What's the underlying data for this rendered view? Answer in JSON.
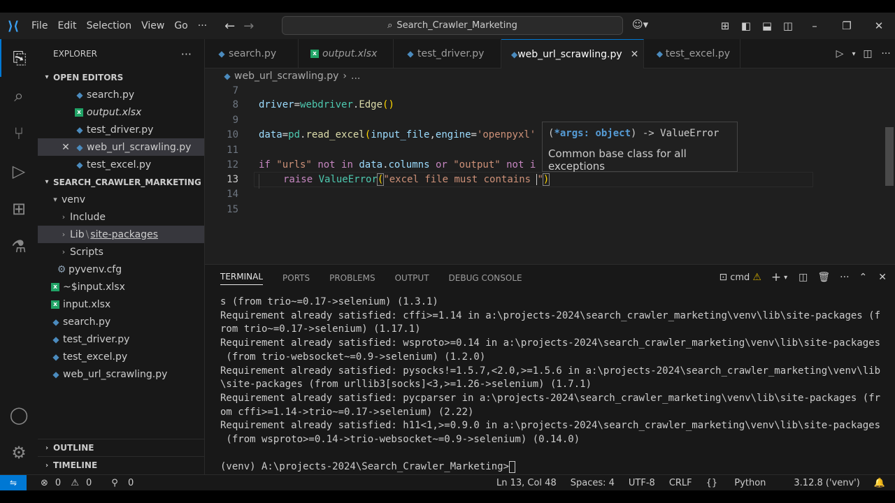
{
  "menu": {
    "items": [
      "File",
      "Edit",
      "Selection",
      "View",
      "Go",
      "···"
    ]
  },
  "command_center": {
    "text": "Search_Crawler_Marketing"
  },
  "sidebar": {
    "title": "EXPLORER",
    "open_editors": {
      "label": "OPEN EDITORS",
      "items": [
        "search.py",
        "output.xlsx",
        "test_driver.py",
        "web_url_scrawling.py",
        "test_excel.py"
      ]
    },
    "project": {
      "label": "SEARCH_CRAWLER_MARKETING",
      "items": [
        "venv",
        "Include",
        "Lib",
        "site-packages",
        "Scripts",
        "pyvenv.cfg",
        "~$input.xlsx",
        "input.xlsx",
        "search.py",
        "test_driver.py",
        "test_excel.py",
        "web_url_scrawling.py"
      ]
    },
    "outline": "OUTLINE",
    "timeline": "TIMELINE"
  },
  "tabs": [
    "search.py",
    "output.xlsx",
    "test_driver.py",
    "web_url_scrawling.py",
    "test_excel.py"
  ],
  "breadcrumb": {
    "file": "web_url_scrawling.py",
    "rest": "..."
  },
  "editor": {
    "line_numbers": [
      "7",
      "8",
      "9",
      "10",
      "11",
      "12",
      "13",
      "14",
      "15"
    ],
    "lines": {
      "l8": {
        "a": "driver",
        "b": "=",
        "c": "webdriver",
        "d": ".",
        "e": "Edge",
        "f": "()"
      },
      "l10": {
        "a": "data",
        "b": "=",
        "c": "pd",
        "d": ".",
        "e": "read_excel",
        "f": "(",
        "g": "input_file",
        "h": ",",
        "i": "engine",
        "j": "=",
        "k": "'openpyxl'",
        "l": ")"
      },
      "l12": {
        "a": "if",
        "b": "\"urls\"",
        "c": "not",
        "d": "in",
        "e": "data",
        "f": ".",
        "g": "columns",
        "h": "or",
        "i": "\"output\"",
        "j": "not",
        "k": "i"
      },
      "l13": {
        "a": "raise",
        "b": "ValueError",
        "c": "(",
        "d": "\"excel file must contains ",
        "e": "\"",
        "f": ")"
      }
    },
    "hover": {
      "sig_open": "(",
      "sig_param": "*args: object",
      "sig_close": ") -> ValueError",
      "doc": "Common base class for all exceptions"
    }
  },
  "panel": {
    "tabs": [
      "TERMINAL",
      "PORTS",
      "PROBLEMS",
      "OUTPUT",
      "DEBUG CONSOLE"
    ],
    "shell": "cmd",
    "lines": [
      "s (from trio~=0.17->selenium) (1.3.1)",
      "Requirement already satisfied: cffi>=1.14 in a:\\projects-2024\\search_crawler_marketing\\venv\\lib\\site-packages (f",
      "rom trio~=0.17->selenium) (1.17.1)",
      "Requirement already satisfied: wsproto>=0.14 in a:\\projects-2024\\search_crawler_marketing\\venv\\lib\\site-packages",
      " (from trio-websocket~=0.9->selenium) (1.2.0)",
      "Requirement already satisfied: pysocks!=1.5.7,<2.0,>=1.5.6 in a:\\projects-2024\\search_crawler_marketing\\venv\\lib",
      "\\site-packages (from urllib3[socks]<3,>=1.26->selenium) (1.7.1)",
      "Requirement already satisfied: pycparser in a:\\projects-2024\\search_crawler_marketing\\venv\\lib\\site-packages (fr",
      "om cffi>=1.14->trio~=0.17->selenium) (2.22)",
      "Requirement already satisfied: h11<1,>=0.9.0 in a:\\projects-2024\\search_crawler_marketing\\venv\\lib\\site-packages",
      " (from wsproto>=0.14->trio-websocket~=0.9->selenium) (0.14.0)",
      "",
      "(venv) A:\\projects-2024\\Search_Crawler_Marketing>"
    ]
  },
  "status": {
    "errors": "0",
    "warnings": "0",
    "ports": "0",
    "position": "Ln 13, Col 48",
    "spaces": "Spaces: 4",
    "encoding": "UTF-8",
    "eol": "CRLF",
    "language": "Python",
    "interpreter": "3.12.8 ('venv')"
  }
}
